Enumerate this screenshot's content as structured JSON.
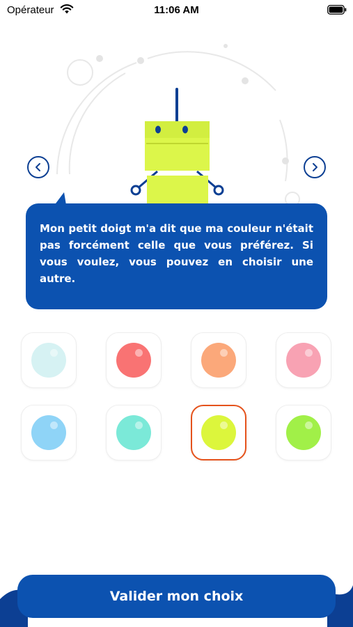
{
  "status_bar": {
    "carrier": "Opérateur",
    "time": "11:06 AM"
  },
  "navigation": {
    "prev_icon": "chevron-left-icon",
    "next_icon": "chevron-right-icon"
  },
  "speech_bubble": {
    "text": "Mon petit doigt m'a dit que ma couleur n'était pas forcément celle que vous préférez. Si vous voulez, vous pouvez en choisir une autre."
  },
  "colors": {
    "primary": "#0c52b0",
    "navy": "#0c3f93",
    "selection_border": "#e5521b",
    "robot_body": "#dcf64a"
  },
  "swatches": [
    {
      "color": "#d6f2f3",
      "selected": false
    },
    {
      "color": "#f97373",
      "selected": false
    },
    {
      "color": "#fba87a",
      "selected": false
    },
    {
      "color": "#f8a2b3",
      "selected": false
    },
    {
      "color": "#8fd4f7",
      "selected": false
    },
    {
      "color": "#7be9d8",
      "selected": false
    },
    {
      "color": "#dcf63c",
      "selected": true
    },
    {
      "color": "#a1f048",
      "selected": false
    }
  ],
  "submit": {
    "label": "Valider mon choix"
  }
}
